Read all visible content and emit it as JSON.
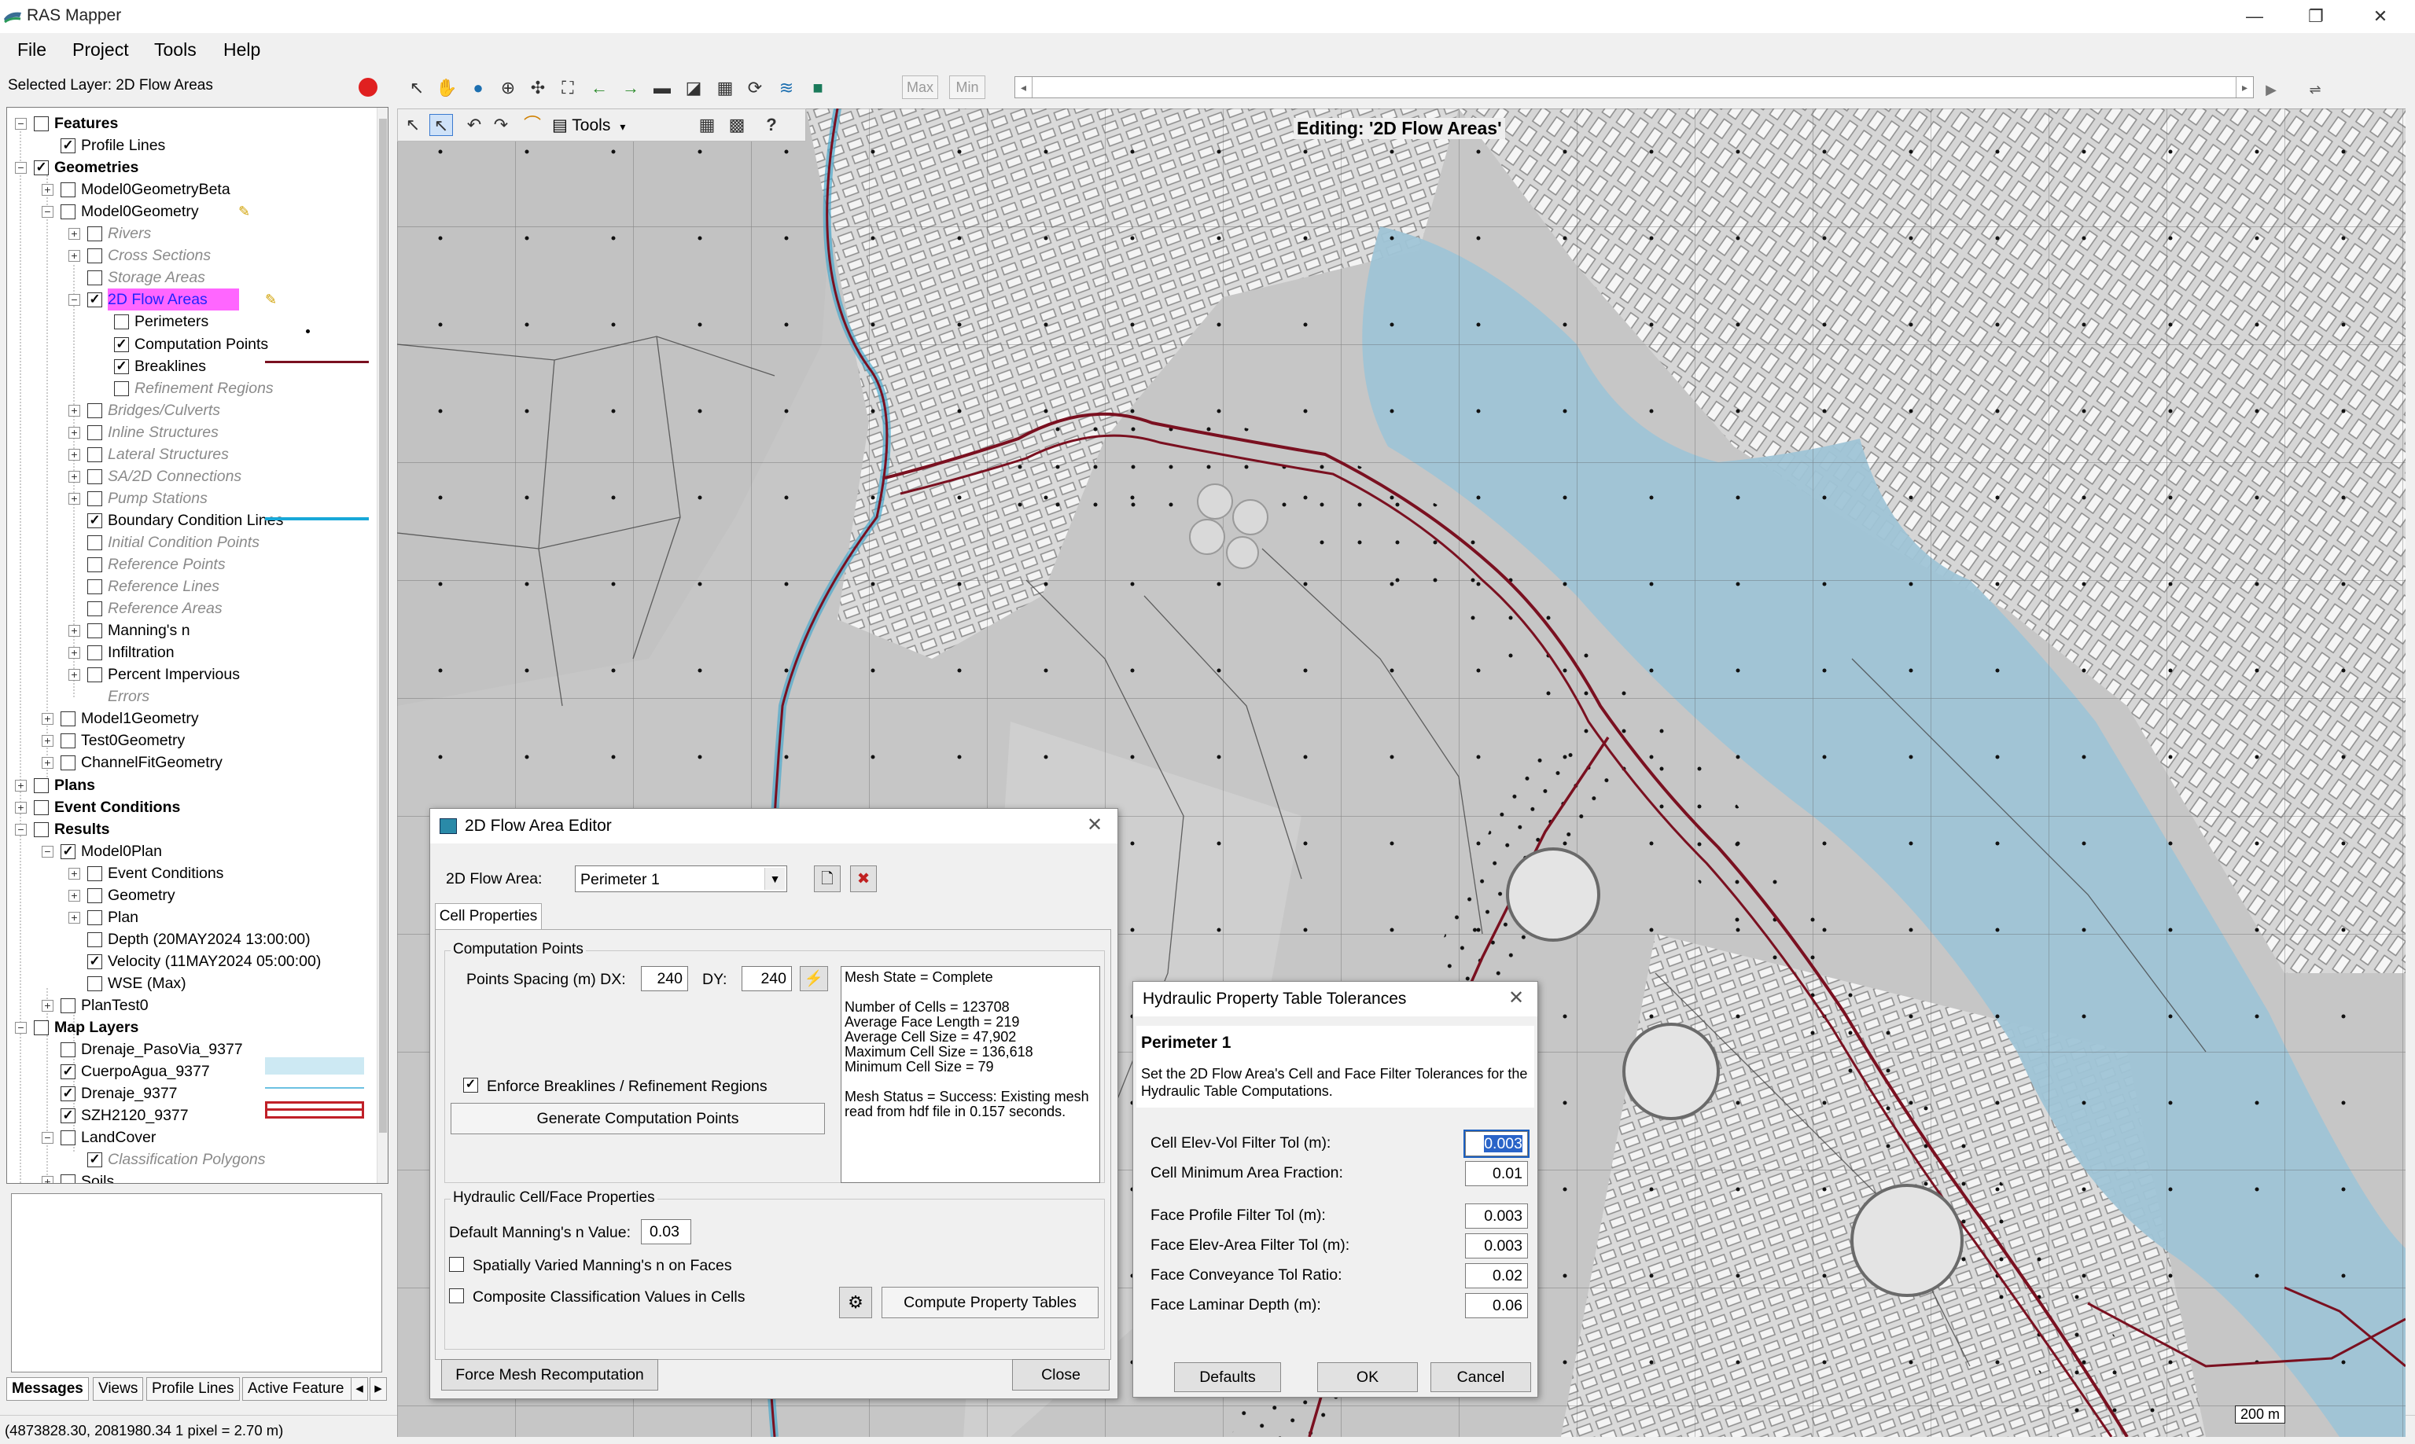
{
  "window": {
    "title": "RAS Mapper",
    "minimize": "—",
    "maximize": "❐",
    "close": "✕"
  },
  "menu": [
    "File",
    "Project",
    "Tools",
    "Help"
  ],
  "selected_layer": "Selected Layer: 2D Flow Areas",
  "toolbar": {
    "max_label": "Max",
    "min_label": "Min"
  },
  "map_tools": {
    "tools_label": "Tools",
    "help_label": "?"
  },
  "map": {
    "editing_label": "Editing: '2D Flow Areas'",
    "scale_label": "200 m",
    "colors": {
      "terrain": "#c9c9c9",
      "water": "#9fc4d6",
      "breakline": "#7a1020"
    }
  },
  "tree": [
    {
      "label": "Features",
      "level": 0,
      "exp": "−",
      "checked": false,
      "bold": true
    },
    {
      "label": "Profile Lines",
      "level": 1,
      "exp": "",
      "checked": true
    },
    {
      "label": "Geometries",
      "level": 0,
      "exp": "−",
      "checked": true,
      "bold": true
    },
    {
      "label": "Model0GeometryBeta",
      "level": 1,
      "exp": "+",
      "checked": false
    },
    {
      "label": "Model0Geometry",
      "level": 1,
      "exp": "−",
      "checked": false,
      "pencil": true
    },
    {
      "label": "Rivers",
      "level": 2,
      "exp": "+",
      "checked": false,
      "gray": true
    },
    {
      "label": "Cross Sections",
      "level": 2,
      "exp": "+",
      "checked": false,
      "gray": true
    },
    {
      "label": "Storage Areas",
      "level": 2,
      "exp": "",
      "checked": false,
      "gray": true
    },
    {
      "label": "2D Flow Areas",
      "level": 2,
      "exp": "−",
      "checked": true,
      "highlight": true,
      "pencil": true
    },
    {
      "label": "Perimeters",
      "level": 3,
      "exp": "",
      "checked": false
    },
    {
      "label": "Computation Points",
      "level": 3,
      "exp": "",
      "checked": true
    },
    {
      "label": "Breaklines",
      "level": 3,
      "exp": "",
      "checked": true
    },
    {
      "label": "Refinement Regions",
      "level": 3,
      "exp": "",
      "checked": false,
      "gray": true
    },
    {
      "label": "Bridges/Culverts",
      "level": 2,
      "exp": "+",
      "checked": false,
      "gray": true
    },
    {
      "label": "Inline Structures",
      "level": 2,
      "exp": "+",
      "checked": false,
      "gray": true
    },
    {
      "label": "Lateral Structures",
      "level": 2,
      "exp": "+",
      "checked": false,
      "gray": true
    },
    {
      "label": "SA/2D Connections",
      "level": 2,
      "exp": "+",
      "checked": false,
      "gray": true
    },
    {
      "label": "Pump Stations",
      "level": 2,
      "exp": "+",
      "checked": false,
      "gray": true
    },
    {
      "label": "Boundary Condition Lines",
      "level": 2,
      "exp": "",
      "checked": true
    },
    {
      "label": "Initial Condition Points",
      "level": 2,
      "exp": "",
      "checked": false,
      "gray": true
    },
    {
      "label": "Reference Points",
      "level": 2,
      "exp": "",
      "checked": false,
      "gray": true
    },
    {
      "label": "Reference Lines",
      "level": 2,
      "exp": "",
      "checked": false,
      "gray": true
    },
    {
      "label": "Reference Areas",
      "level": 2,
      "exp": "",
      "checked": false,
      "gray": true
    },
    {
      "label": "Manning's n",
      "level": 2,
      "exp": "+",
      "checked": false
    },
    {
      "label": "Infiltration",
      "level": 2,
      "exp": "+",
      "checked": false
    },
    {
      "label": "Percent Impervious",
      "level": 2,
      "exp": "+",
      "checked": false
    },
    {
      "label": "Errors",
      "level": 2,
      "exp": "",
      "checked": false,
      "gray": true,
      "nocb": true
    },
    {
      "label": "Model1Geometry",
      "level": 1,
      "exp": "+",
      "checked": false
    },
    {
      "label": "Test0Geometry",
      "level": 1,
      "exp": "+",
      "checked": false
    },
    {
      "label": "ChannelFitGeometry",
      "level": 1,
      "exp": "+",
      "checked": false
    },
    {
      "label": "Plans",
      "level": 0,
      "exp": "+",
      "checked": false,
      "bold": true
    },
    {
      "label": "Event Conditions",
      "level": 0,
      "exp": "+",
      "checked": false,
      "bold": true
    },
    {
      "label": "Results",
      "level": 0,
      "exp": "−",
      "checked": false,
      "bold": true
    },
    {
      "label": "Model0Plan",
      "level": 1,
      "exp": "−",
      "checked": true
    },
    {
      "label": "Event Conditions",
      "level": 2,
      "exp": "+",
      "checked": false
    },
    {
      "label": "Geometry",
      "level": 2,
      "exp": "+",
      "checked": false
    },
    {
      "label": "Plan",
      "level": 2,
      "exp": "+",
      "checked": false
    },
    {
      "label": "Depth (20MAY2024 13:00:00)",
      "level": 2,
      "exp": "",
      "checked": false
    },
    {
      "label": "Velocity (11MAY2024 05:00:00)",
      "level": 2,
      "exp": "",
      "checked": true
    },
    {
      "label": "WSE (Max)",
      "level": 2,
      "exp": "",
      "checked": false
    },
    {
      "label": "PlanTest0",
      "level": 1,
      "exp": "+",
      "checked": false
    },
    {
      "label": "Map Layers",
      "level": 0,
      "exp": "−",
      "checked": false,
      "bold": true
    },
    {
      "label": "Drenaje_PasoVia_9377",
      "level": 1,
      "exp": "",
      "checked": false
    },
    {
      "label": "CuerpoAgua_9377",
      "level": 1,
      "exp": "",
      "checked": true
    },
    {
      "label": "Drenaje_9377",
      "level": 1,
      "exp": "",
      "checked": true
    },
    {
      "label": "SZH2120_9377",
      "level": 1,
      "exp": "",
      "checked": true
    },
    {
      "label": "LandCover",
      "level": 1,
      "exp": "−",
      "checked": false
    },
    {
      "label": "Classification Polygons",
      "level": 2,
      "exp": "",
      "checked": true,
      "gray": true
    },
    {
      "label": "Soils",
      "level": 1,
      "exp": "+",
      "checked": false
    }
  ],
  "bottom_tabs": [
    "Messages",
    "Views",
    "Profile Lines",
    "Active Feature"
  ],
  "status_text": "(4873828.30, 2081980.34  1 pixel = 2.70 m)",
  "editor": {
    "title": "2D Flow Area Editor",
    "flow_area_label": "2D Flow Area:",
    "flow_area_value": "Perimeter 1",
    "tab": "Cell Properties",
    "computation_points_group": "Computation Points",
    "spacing_label": "Points Spacing (m) DX:",
    "dx": "240",
    "dy_label": "DY:",
    "dy": "240",
    "mesh_info": [
      "Mesh State = Complete",
      "",
      "Number of Cells = 123708",
      "Average Face Length = 219",
      "Average Cell Size = 47,902",
      "Maximum Cell Size = 136,618",
      "Minimum Cell Size = 79",
      "",
      "Mesh Status = Success: Existing mesh",
      "read from hdf file in 0.157 seconds."
    ],
    "enforce_label": "Enforce Breaklines / Refinement Regions",
    "generate_btn": "Generate Computation Points",
    "hydraulic_group": "Hydraulic Cell/Face Properties",
    "mannings_label": "Default Manning's n Value:",
    "mannings_value": "0.03",
    "spatial_label": "Spatially Varied Manning's n on Faces",
    "composite_label": "Composite Classification Values in Cells",
    "compute_btn": "Compute Property Tables",
    "force_btn": "Force Mesh Recomputation",
    "close_btn": "Close"
  },
  "tolerances": {
    "title": "Hydraulic Property Table Tolerances",
    "heading": "Perimeter 1",
    "desc": "Set the 2D Flow Area's Cell and Face Filter Tolerances for the Hydraulic Table Computations.",
    "fields": [
      {
        "label": "Cell Elev-Vol Filter Tol (m):",
        "value": "0.003"
      },
      {
        "label": "Cell Minimum Area Fraction:",
        "value": "0.01"
      },
      {
        "label": "Face Profile Filter Tol (m):",
        "value": "0.003"
      },
      {
        "label": "Face Elev-Area Filter Tol (m):",
        "value": "0.003"
      },
      {
        "label": "Face Conveyance Tol Ratio:",
        "value": "0.02"
      },
      {
        "label": "Face Laminar Depth (m):",
        "value": "0.06"
      }
    ],
    "defaults_btn": "Defaults",
    "ok_btn": "OK",
    "cancel_btn": "Cancel"
  }
}
